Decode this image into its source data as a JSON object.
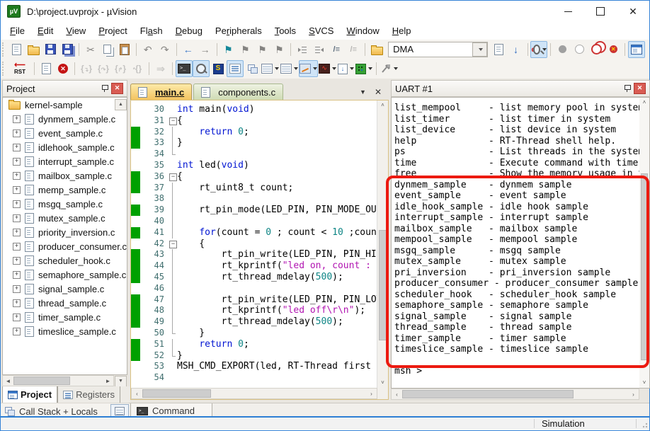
{
  "window": {
    "title": "D:\\project.uvprojx - µVision"
  },
  "menu": {
    "items": [
      {
        "label": "File",
        "u": 0
      },
      {
        "label": "Edit",
        "u": 0
      },
      {
        "label": "View",
        "u": 0
      },
      {
        "label": "Project",
        "u": 0
      },
      {
        "label": "Flash",
        "u": 2
      },
      {
        "label": "Debug",
        "u": 0
      },
      {
        "label": "Peripherals",
        "u": 2
      },
      {
        "label": "Tools",
        "u": 0
      },
      {
        "label": "SVCS",
        "u": 0
      },
      {
        "label": "Window",
        "u": 0
      },
      {
        "label": "Help",
        "u": 0
      }
    ]
  },
  "toolbar": {
    "dma_value": "DMA",
    "rst_label": "RST"
  },
  "project": {
    "title": "Project",
    "root": "kernel-sample",
    "files": [
      "dynmem_sample.c",
      "event_sample.c",
      "idlehook_sample.c",
      "interrupt_sample.c",
      "mailbox_sample.c",
      "memp_sample.c",
      "msgq_sample.c",
      "mutex_sample.c",
      "priority_inversion.c",
      "producer_consumer.c",
      "scheduler_hook.c",
      "semaphore_sample.c",
      "signal_sample.c",
      "thread_sample.c",
      "timer_sample.c",
      "timeslice_sample.c"
    ],
    "tabs": [
      "Project",
      "Registers"
    ],
    "callstack_label": "Call Stack + Locals"
  },
  "editor": {
    "tabs": [
      "main.c",
      "components.c"
    ],
    "command_tab": "Command",
    "lines": [
      {
        "n": 30,
        "g": 0,
        "f": "",
        "segs": [
          [
            "k",
            "int"
          ],
          [
            "d",
            " main("
          ],
          [
            "k",
            "void"
          ],
          [
            "d",
            ")"
          ]
        ]
      },
      {
        "n": 31,
        "g": 0,
        "f": "b",
        "segs": [
          [
            "d",
            "{"
          ]
        ]
      },
      {
        "n": 32,
        "g": 1,
        "f": "l",
        "segs": [
          [
            "d",
            "    "
          ],
          [
            "k",
            "return"
          ],
          [
            "d",
            " "
          ],
          [
            "n",
            "0"
          ],
          [
            "d",
            ";"
          ]
        ]
      },
      {
        "n": 33,
        "g": 1,
        "f": "l",
        "segs": [
          [
            "d",
            "}"
          ]
        ]
      },
      {
        "n": 34,
        "g": 0,
        "f": "e",
        "segs": []
      },
      {
        "n": 35,
        "g": 0,
        "f": "",
        "segs": [
          [
            "k",
            "int"
          ],
          [
            "d",
            " led("
          ],
          [
            "k",
            "void"
          ],
          [
            "d",
            ")"
          ]
        ]
      },
      {
        "n": 36,
        "g": 1,
        "f": "b",
        "segs": [
          [
            "d",
            "{"
          ]
        ]
      },
      {
        "n": 37,
        "g": 1,
        "f": "l",
        "segs": [
          [
            "d",
            "    rt_uint8_t count;"
          ]
        ]
      },
      {
        "n": 38,
        "g": 0,
        "f": "l",
        "segs": []
      },
      {
        "n": 39,
        "g": 1,
        "f": "l",
        "segs": [
          [
            "d",
            "    rt_pin_mode(LED_PIN, PIN_MODE_OUTPUT);"
          ]
        ]
      },
      {
        "n": 40,
        "g": 0,
        "f": "l",
        "segs": []
      },
      {
        "n": 41,
        "g": 1,
        "f": "l",
        "segs": [
          [
            "d",
            "    "
          ],
          [
            "k",
            "for"
          ],
          [
            "d",
            "(count = "
          ],
          [
            "n",
            "0"
          ],
          [
            "d",
            " ; count < "
          ],
          [
            "n",
            "10"
          ],
          [
            "d",
            " ;count++)"
          ]
        ]
      },
      {
        "n": 42,
        "g": 0,
        "f": "b",
        "segs": [
          [
            "d",
            "    {"
          ]
        ]
      },
      {
        "n": 43,
        "g": 1,
        "f": "l",
        "segs": [
          [
            "d",
            "        rt_pin_write(LED_PIN, PIN_HIGH);"
          ]
        ]
      },
      {
        "n": 44,
        "g": 1,
        "f": "l",
        "segs": [
          [
            "d",
            "        rt_kprintf("
          ],
          [
            "s",
            "\"led on, count : %d\\r\\n\""
          ],
          [
            "d",
            ", count);"
          ]
        ]
      },
      {
        "n": 45,
        "g": 1,
        "f": "l",
        "segs": [
          [
            "d",
            "        rt_thread_mdelay("
          ],
          [
            "n",
            "500"
          ],
          [
            "d",
            ");"
          ]
        ]
      },
      {
        "n": 46,
        "g": 0,
        "f": "l",
        "segs": []
      },
      {
        "n": 47,
        "g": 1,
        "f": "l",
        "segs": [
          [
            "d",
            "        rt_pin_write(LED_PIN, PIN_LOW);"
          ]
        ]
      },
      {
        "n": 48,
        "g": 1,
        "f": "l",
        "segs": [
          [
            "d",
            "        rt_kprintf("
          ],
          [
            "s",
            "\"led off\\r\\n\""
          ],
          [
            "d",
            ");"
          ]
        ]
      },
      {
        "n": 49,
        "g": 1,
        "f": "l",
        "segs": [
          [
            "d",
            "        rt_thread_mdelay("
          ],
          [
            "n",
            "500"
          ],
          [
            "d",
            ");"
          ]
        ]
      },
      {
        "n": 50,
        "g": 0,
        "f": "e",
        "segs": [
          [
            "d",
            "    }"
          ]
        ]
      },
      {
        "n": 51,
        "g": 1,
        "f": "l",
        "segs": [
          [
            "d",
            "    "
          ],
          [
            "k",
            "return"
          ],
          [
            "d",
            " "
          ],
          [
            "n",
            "0"
          ],
          [
            "d",
            ";"
          ]
        ]
      },
      {
        "n": 52,
        "g": 1,
        "f": "e",
        "segs": [
          [
            "d",
            "}"
          ]
        ]
      },
      {
        "n": 53,
        "g": 0,
        "f": "",
        "segs": [
          [
            "d",
            "MSH_CMD_EXPORT(led, RT-Thread first led sample);"
          ]
        ]
      },
      {
        "n": 54,
        "g": 0,
        "f": "",
        "segs": []
      }
    ]
  },
  "uart": {
    "title": "UART #1",
    "lines": [
      "list_mempool     - list memory pool in system",
      "list_timer       - list timer in system",
      "list_device      - list device in system",
      "help             - RT-Thread shell help.",
      "ps               - List threads in the system.",
      "time             - Execute command with time.",
      "free             - Show the memory usage in the system.",
      "dynmem_sample    - dynmem sample",
      "event_sample     - event sample",
      "idle_hook_sample - idle hook sample",
      "interrupt_sample - interrupt sample",
      "mailbox_sample   - mailbox sample",
      "mempool_sample   - mempool sample",
      "msgq_sample      - msgq sample",
      "mutex_sample     - mutex sample",
      "pri_inversion    - pri_inversion sample",
      "producer_consumer - producer_consumer sample",
      "scheduler_hook   - scheduler_hook sample",
      "semaphore_sample - semaphore sample",
      "signal_sample    - signal sample",
      "thread_sample    - thread sample",
      "timer_sample     - timer sample",
      "timeslice_sample - timeslice sample",
      "",
      "msh >"
    ]
  },
  "status": {
    "simulation": "Simulation"
  },
  "colors": {
    "accent_blue": "#2e7fd4",
    "toolbar_highlight": "#cfe4f7",
    "change_bar_green": "#00a000",
    "annotation_red": "#ec1a10",
    "active_tab_orange": "#f3c35f",
    "inactive_tab_green": "#cfdcb4",
    "keyword": "#0014d2",
    "string": "#b114b1",
    "number": "#0e8585",
    "line_number": "#3f6e6e"
  }
}
